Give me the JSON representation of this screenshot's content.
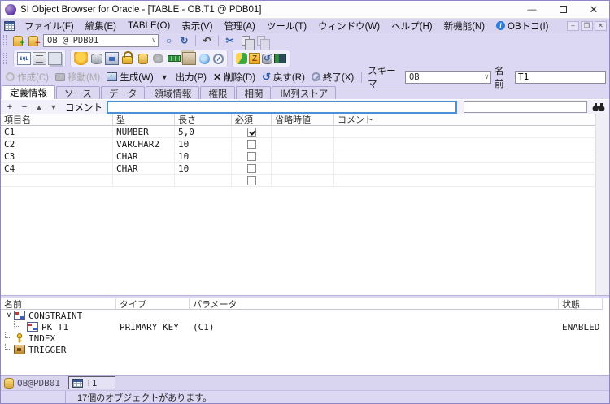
{
  "window": {
    "title": "SI Object Browser for Oracle - [TABLE - OB.T1 @ PDB01]"
  },
  "menu": {
    "items": [
      {
        "label": "ファイル(F)"
      },
      {
        "label": "編集(E)"
      },
      {
        "label": "TABLE(O)"
      },
      {
        "label": "表示(V)"
      },
      {
        "label": "管理(A)"
      },
      {
        "label": "ツール(T)"
      },
      {
        "label": "ウィンドウ(W)"
      },
      {
        "label": "ヘルプ(H)"
      },
      {
        "label": "新機能(N)"
      },
      {
        "label": "OBトコ(I)"
      }
    ]
  },
  "toolbar1": {
    "connection": "OB @ PDB01",
    "circle_glyph": "○",
    "refresh_glyph": "↻",
    "undo_glyph": "↶",
    "cut_glyph": "✂"
  },
  "toolbar2": {
    "sql_label": "SQL",
    "z_label": "Z"
  },
  "actionbar": {
    "create": "作成(C)",
    "move": "移動(M)",
    "generate": "生成(W)",
    "output": "出力(P)",
    "delete": "削除(D)",
    "revert": "戻す(R)",
    "quit": "終了(X)",
    "schema_label": "スキーマ",
    "schema_value": "OB",
    "name_label": "名前",
    "name_value": "T1"
  },
  "tabs": [
    {
      "label": "定義情報"
    },
    {
      "label": "ソース"
    },
    {
      "label": "データ"
    },
    {
      "label": "領域情報"
    },
    {
      "label": "権限"
    },
    {
      "label": "相関"
    },
    {
      "label": "IM列ストア"
    }
  ],
  "gridtools": {
    "add": "+",
    "remove": "−",
    "up": "▲",
    "down": "▼",
    "comment_label": "コメント",
    "comment_value": "",
    "search_value": ""
  },
  "grid": {
    "headers": [
      "項目名",
      "型",
      "長さ",
      "必須",
      "省略時値",
      "コメント"
    ],
    "rows": [
      {
        "name": "C1",
        "type": "NUMBER",
        "length": "5,0",
        "required": true,
        "default": "",
        "comment": ""
      },
      {
        "name": "C2",
        "type": "VARCHAR2",
        "length": "10",
        "required": false,
        "default": "",
        "comment": ""
      },
      {
        "name": "C3",
        "type": "CHAR",
        "length": "10",
        "required": false,
        "default": "",
        "comment": ""
      },
      {
        "name": "C4",
        "type": "CHAR",
        "length": "10",
        "required": false,
        "default": "",
        "comment": ""
      },
      {
        "name": "",
        "type": "",
        "length": "",
        "required": false,
        "default": "",
        "comment": ""
      }
    ]
  },
  "bottom": {
    "headers": [
      "名前",
      "タイプ",
      "パラメータ",
      "状態"
    ],
    "tree": [
      {
        "label": "CONSTRAINT",
        "type": "",
        "params": "",
        "status": ""
      },
      {
        "label": "PK_T1",
        "type": "PRIMARY KEY",
        "params": "(C1)",
        "status": "ENABLED"
      },
      {
        "label": "INDEX",
        "type": "",
        "params": "",
        "status": ""
      },
      {
        "label": "TRIGGER",
        "type": "",
        "params": "",
        "status": ""
      }
    ],
    "expander_glyph": "∨"
  },
  "mdi_tabs": {
    "session": "OB@PDB01",
    "table": "T1"
  },
  "statusbar": {
    "message": "17個のオブジェクトがあります。"
  }
}
